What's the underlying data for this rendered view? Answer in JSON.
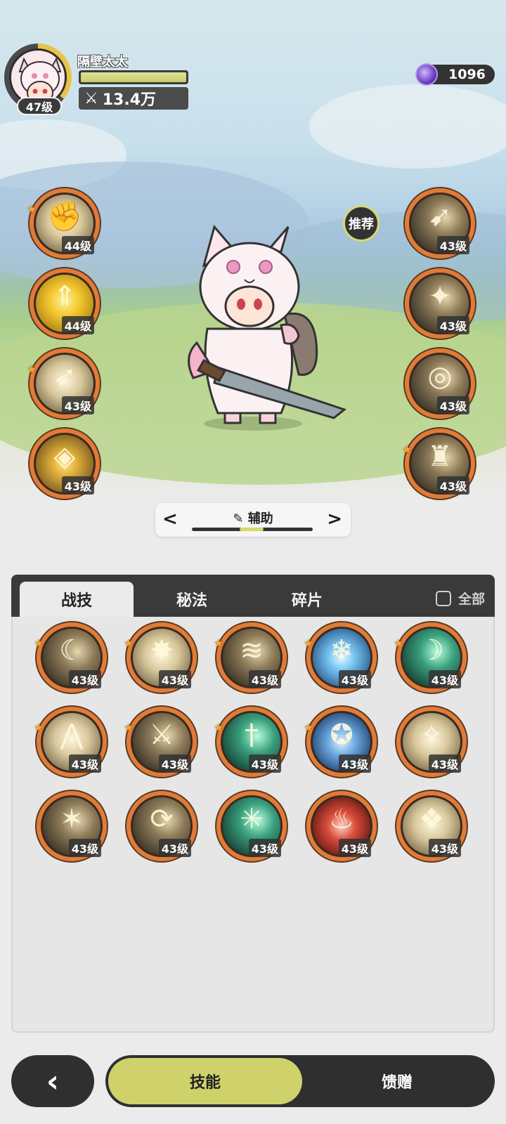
{
  "player": {
    "name": "隔壁太太",
    "level": "47级",
    "power": "13.4万",
    "hp_fill": 1.0
  },
  "currency": {
    "amount": "1096",
    "icon": "purple-gem-icon"
  },
  "left_skills": [
    {
      "level": "44级",
      "starred": true,
      "icon": "fist-burst-icon"
    },
    {
      "level": "44级",
      "starred": false,
      "icon": "gold-crown-arrows-icon"
    },
    {
      "level": "43级",
      "starred": true,
      "icon": "bow-slash-icon"
    },
    {
      "level": "43级",
      "starred": false,
      "icon": "diamond-runes-icon"
    }
  ],
  "right_skills": [
    {
      "level": "43级",
      "starred": false,
      "icon": "spear-thrust-icon"
    },
    {
      "level": "43级",
      "starred": false,
      "icon": "creature-claw-icon"
    },
    {
      "level": "43级",
      "starred": false,
      "icon": "swirl-strike-icon"
    },
    {
      "level": "43级",
      "starred": true,
      "icon": "golem-guard-icon"
    }
  ],
  "recommend_label": "推荐",
  "category": {
    "label": "辅助",
    "prev": "<",
    "next": ">"
  },
  "tabs": [
    {
      "label": "战技",
      "active": true
    },
    {
      "label": "秘法",
      "active": false
    },
    {
      "label": "碎片",
      "active": false
    }
  ],
  "all_label": "全部",
  "grid_skills": [
    {
      "level": "43级",
      "starred": true,
      "icon": "crescent-strike-icon"
    },
    {
      "level": "43级",
      "starred": true,
      "icon": "explosion-icon"
    },
    {
      "level": "43级",
      "starred": true,
      "icon": "wind-slash-icon"
    },
    {
      "level": "43级",
      "starred": true,
      "icon": "ice-shatter-icon"
    },
    {
      "level": "43级",
      "starred": true,
      "icon": "teal-crescent-icon"
    },
    {
      "level": "43级",
      "starred": true,
      "icon": "spike-burst-icon"
    },
    {
      "level": "43级",
      "starred": true,
      "icon": "swordsman-leap-icon"
    },
    {
      "level": "43级",
      "starred": true,
      "icon": "green-sword-icon"
    },
    {
      "level": "43级",
      "starred": true,
      "icon": "blue-vortex-icon"
    },
    {
      "level": "43级",
      "starred": false,
      "icon": "sparkle-punch-icon"
    },
    {
      "level": "43级",
      "starred": false,
      "icon": "shooting-stars-icon"
    },
    {
      "level": "43级",
      "starred": false,
      "icon": "whirlwind-icon"
    },
    {
      "level": "43级",
      "starred": false,
      "icon": "web-net-icon"
    },
    {
      "level": "43级",
      "starred": false,
      "icon": "red-rise-icon"
    },
    {
      "level": "43级",
      "starred": false,
      "icon": "shadow-clone-icon"
    }
  ],
  "bottom": {
    "back_icon": "back-chevron-icon",
    "skill_label": "技能",
    "gift_label": "馈赠"
  }
}
